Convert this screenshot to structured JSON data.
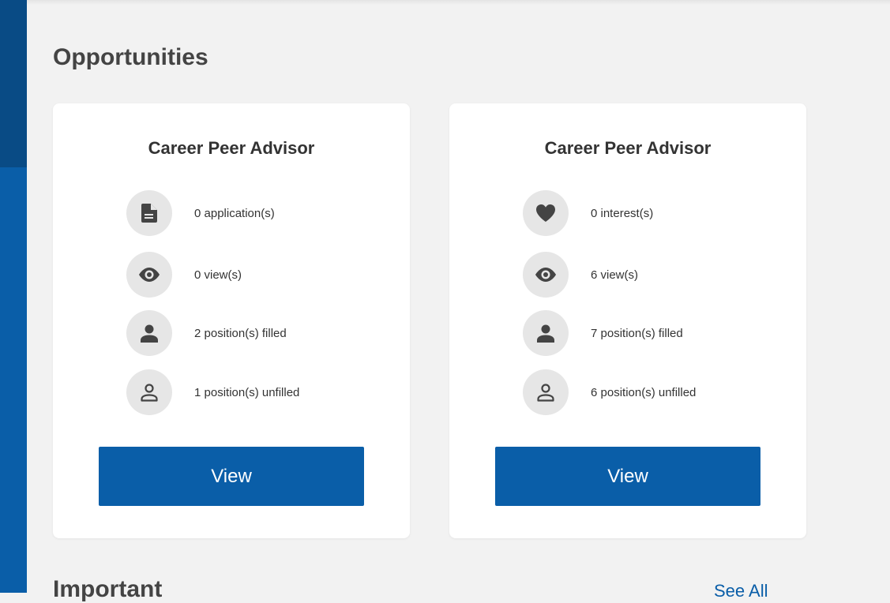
{
  "section_title": "Opportunities",
  "cards": [
    {
      "title": "Career Peer Advisor",
      "stats": [
        {
          "icon": "document-icon",
          "text": "0 application(s)"
        },
        {
          "icon": "eye-icon",
          "text": "0 view(s)"
        },
        {
          "icon": "person-filled-icon",
          "text": "2 position(s) filled"
        },
        {
          "icon": "person-outline-icon",
          "text": "1 position(s) unfilled"
        }
      ],
      "button_label": "View"
    },
    {
      "title": "Career Peer Advisor",
      "stats": [
        {
          "icon": "heart-icon",
          "text": "0 interest(s)"
        },
        {
          "icon": "eye-icon",
          "text": "6 view(s)"
        },
        {
          "icon": "person-filled-icon",
          "text": "7 position(s) filled"
        },
        {
          "icon": "person-outline-icon",
          "text": "6 position(s) unfilled"
        }
      ],
      "button_label": "View"
    }
  ],
  "important": {
    "title": "Important",
    "see_all_label": "See All"
  },
  "colors": {
    "primary": "#0a5ea8",
    "sidebar_dark": "#094b85",
    "background": "#f2f2f2",
    "icon_bg": "#e6e6e6",
    "icon_fg": "#444444"
  }
}
